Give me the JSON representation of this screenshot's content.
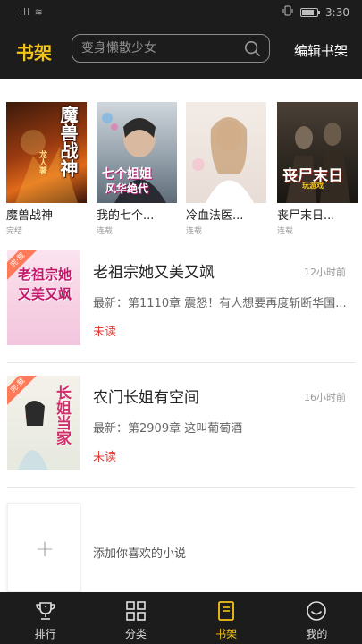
{
  "status_bar": {
    "signal": "ıll ≋",
    "time": "3:30",
    "battery_level": 0.8
  },
  "header": {
    "title": "书架",
    "search_placeholder": "变身懒散少女",
    "edit_label": "编辑书架"
  },
  "grid_books": [
    {
      "title": "魔兽战神",
      "status": "完结",
      "cover_text": "魔兽战神",
      "cover_sub": "龙人著"
    },
    {
      "title": "我的七个...",
      "status": "连载",
      "cover_text": "七个姐姐",
      "cover_sub": "风华绝代"
    },
    {
      "title": "冷血法医...",
      "status": "连载",
      "cover_text": "",
      "cover_sub": ""
    },
    {
      "title": "丧尸末日...",
      "status": "连载",
      "cover_text": "丧尸末日",
      "cover_sub": "玩游戏"
    }
  ],
  "list_books": [
    {
      "title": "老祖宗她又美又飒",
      "time": "12小时前",
      "latest": "最新：第1110章 震怒！有人想要再度斩断华国...",
      "unread": "未读",
      "tag": "完·载",
      "cover_text": "老祖宗她又美又飒"
    },
    {
      "title": "农门长姐有空间",
      "time": "16小时前",
      "latest": "最新：第2909章 这叫葡萄酒",
      "unread": "未读",
      "tag": "完·载",
      "cover_text": "长姐当家"
    }
  ],
  "add_card": {
    "plus": "+",
    "label": "添加你喜欢的小说"
  },
  "bottom_nav": [
    {
      "label": "排行",
      "icon": "trophy-icon",
      "active": false
    },
    {
      "label": "分类",
      "icon": "grid-icon",
      "active": false
    },
    {
      "label": "书架",
      "icon": "book-icon",
      "active": true
    },
    {
      "label": "我的",
      "icon": "smile-icon",
      "active": false
    }
  ],
  "colors": {
    "accent": "#f5c518",
    "bar_bg": "#1c1c1c",
    "unread": "#e53935"
  }
}
